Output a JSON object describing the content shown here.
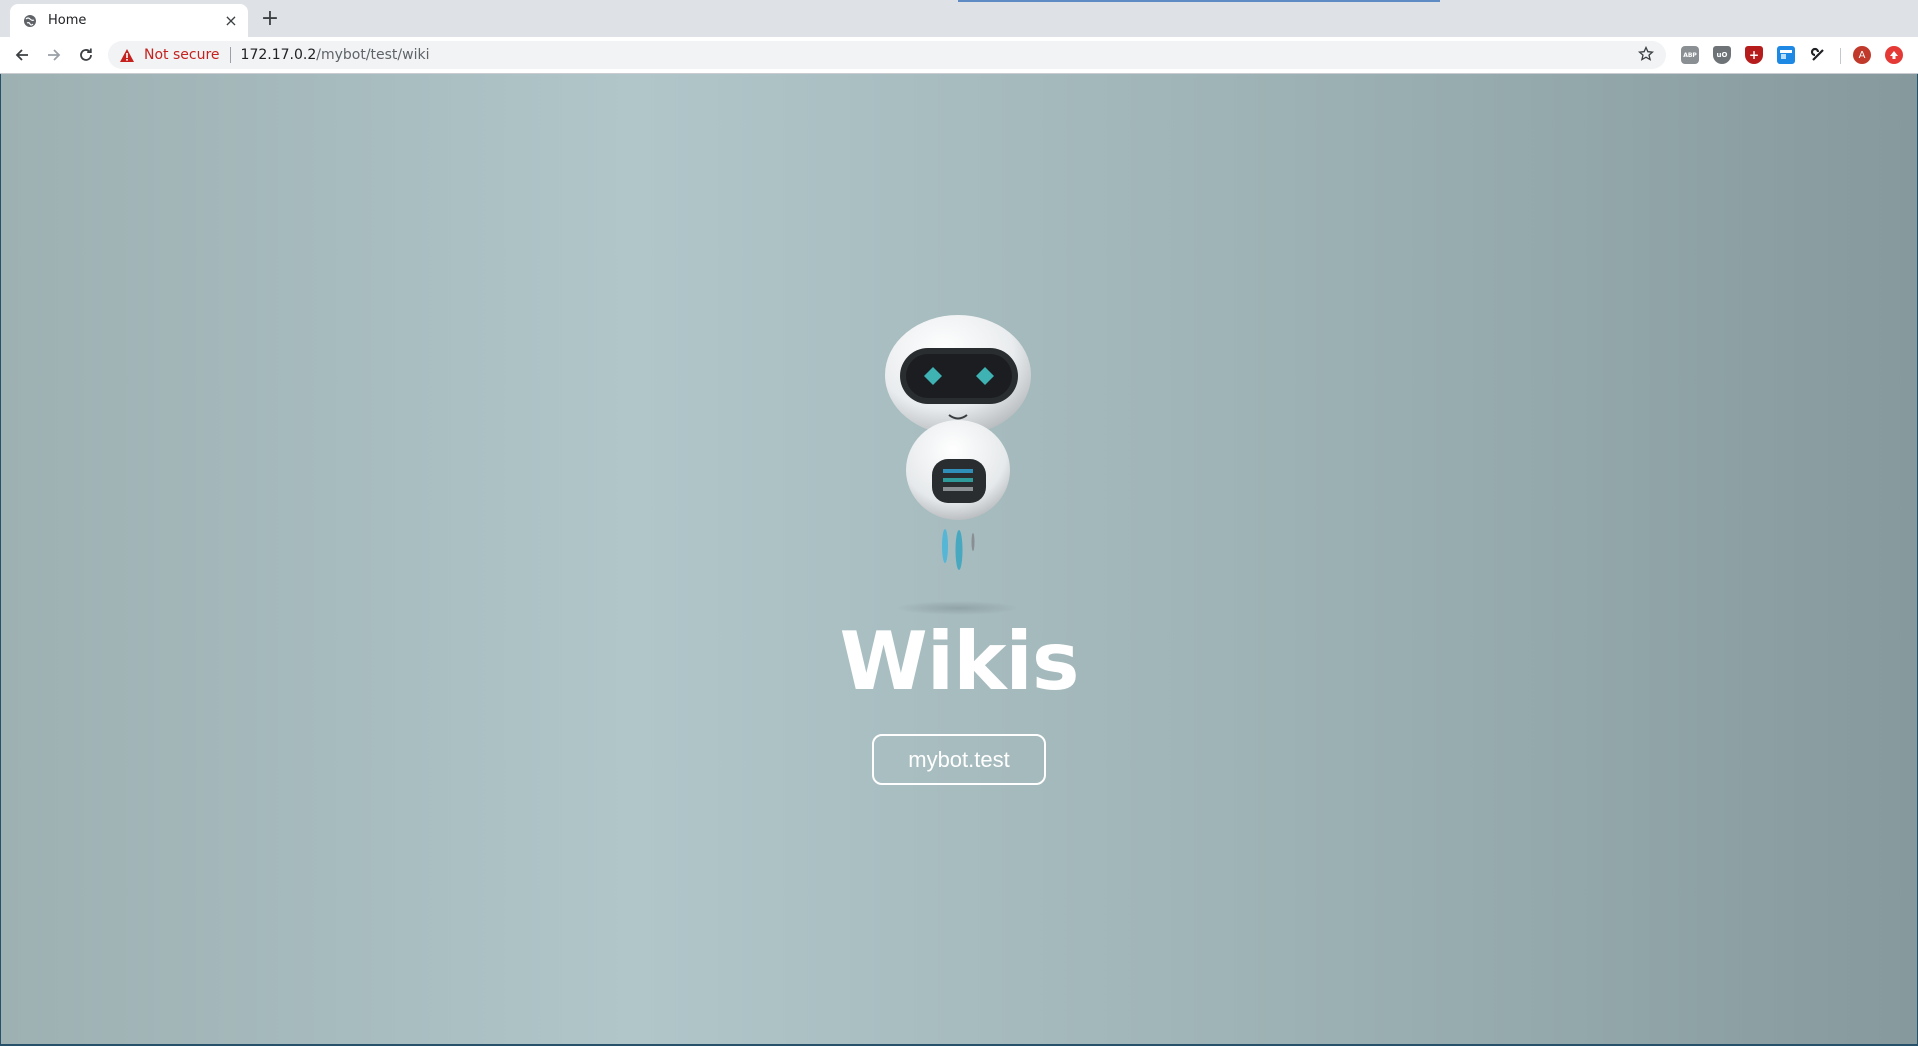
{
  "browser": {
    "tab": {
      "title": "Home",
      "close_icon": "close-icon",
      "favicon": "globe-icon"
    },
    "new_tab_icon": "plus-icon",
    "nav": {
      "back_icon": "arrow-left-icon",
      "forward_icon": "arrow-right-icon",
      "reload_icon": "reload-icon"
    },
    "omnibox": {
      "security_label": "Not secure",
      "security_icon": "warning-icon",
      "url_host": "172.17.0.2",
      "url_path": "/mybot/test/wiki",
      "bookmark_icon": "star-icon"
    },
    "extensions": [
      {
        "name": "abp-extension-icon",
        "label": "ABP",
        "color": "#8a8f94"
      },
      {
        "name": "ublock-extension-icon",
        "label": "uO",
        "color": "#6e7378"
      },
      {
        "name": "shield-extension-icon",
        "label": "+",
        "color": "#b71c1c"
      },
      {
        "name": "window-extension-icon",
        "label": "",
        "color": "#1e88e5"
      },
      {
        "name": "puzzle-extension-icon",
        "label": "",
        "color": "#202124"
      }
    ],
    "profile": {
      "initial": "A",
      "color": "#c0392b"
    },
    "update_icon": "update-icon",
    "colors": {
      "warning": "#c5221f",
      "progress": "#5f8bc4"
    }
  },
  "page": {
    "title": "Wikis",
    "bot_button_label": "mybot.test",
    "mascot": "robot-mascot",
    "background": {
      "left": "#9db0b2",
      "center": "#b0c6c9",
      "right": "#86999d"
    }
  }
}
